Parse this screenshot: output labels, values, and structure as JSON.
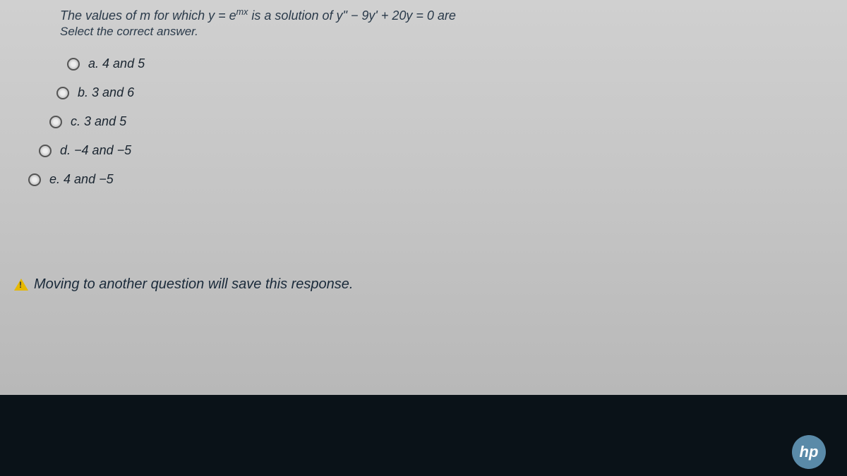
{
  "question": {
    "prefix": "The values of m for which ",
    "expr1": "y = e",
    "sup1": "mx",
    "middle": " is a solution of ",
    "expr2": "y\" − 9y' + 20y = 0",
    "suffix": " are"
  },
  "instruction": "Select the correct answer.",
  "options": [
    {
      "letter": "a.",
      "text": "4 and 5"
    },
    {
      "letter": "b.",
      "text": "3 and 6"
    },
    {
      "letter": "c.",
      "text": "3 and 5"
    },
    {
      "letter": "d.",
      "text": "−4 and −5"
    },
    {
      "letter": "e.",
      "text": "4 and −5"
    }
  ],
  "footer": "Moving to another question will save this response.",
  "logo": "hp"
}
